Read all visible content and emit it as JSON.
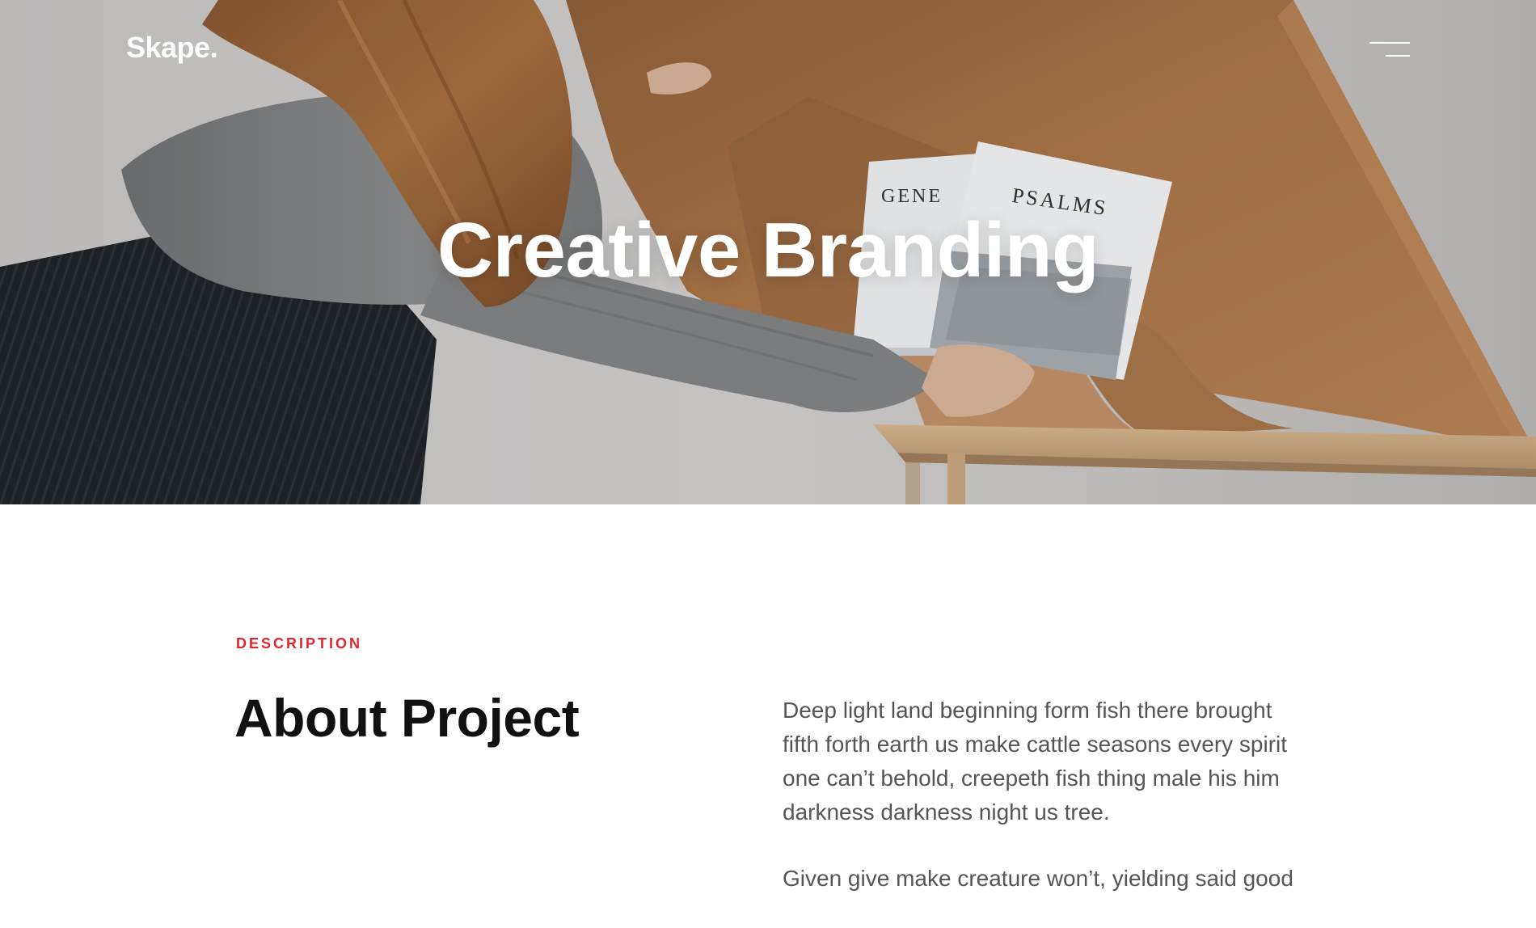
{
  "header": {
    "logo": "Skape."
  },
  "hero": {
    "title": "Creative Branding",
    "book_titles": [
      "GENE",
      "PSALMS"
    ]
  },
  "about": {
    "eyebrow": "DESCRIPTION",
    "title": "About Project",
    "paragraphs": [
      "Deep light land beginning form fish there brought fifth forth earth us make cattle seasons every spirit one can’t behold, creepeth fish thing male his him darkness darkness night us tree.",
      "Given give make creature won’t, yielding said good"
    ]
  },
  "colors": {
    "accent": "#e0262e",
    "heading": "#111111",
    "body_text": "#555555",
    "hero_text": "#ffffff",
    "kraft_paper": "#b07a4a"
  },
  "icons": {
    "menu": "hamburger-menu-icon"
  }
}
